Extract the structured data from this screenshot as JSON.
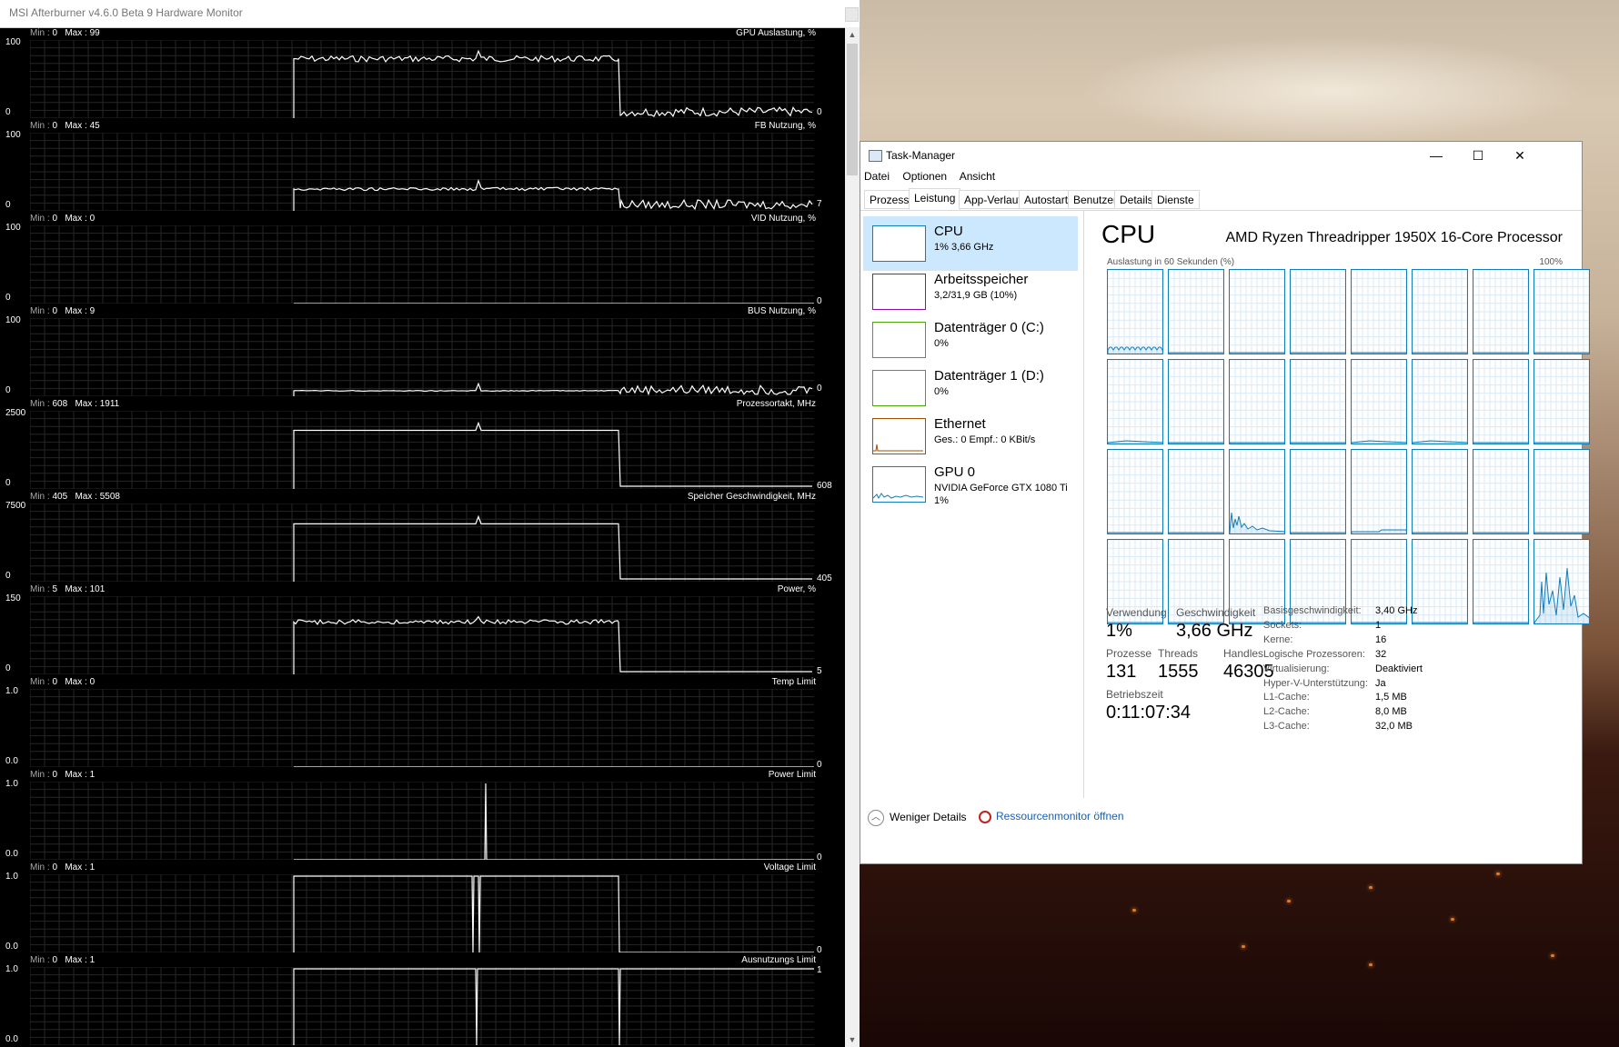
{
  "msi": {
    "title": "MSI Afterburner v4.6.0 Beta 9 Hardware Monitor",
    "graphs": [
      {
        "name": "GPU Auslastung, %",
        "min": "0",
        "max": "99",
        "ytop": "100",
        "ybot": "0",
        "current": "0"
      },
      {
        "name": "FB Nutzung, %",
        "min": "0",
        "max": "45",
        "ytop": "100",
        "ybot": "0",
        "current": "7"
      },
      {
        "name": "VID Nutzung, %",
        "min": "0",
        "max": "0",
        "ytop": "100",
        "ybot": "0",
        "current": "0"
      },
      {
        "name": "BUS Nutzung, %",
        "min": "0",
        "max": "9",
        "ytop": "100",
        "ybot": "0",
        "current": "0"
      },
      {
        "name": "Prozessortakt, MHz",
        "min": "608",
        "max": "1911",
        "ytop": "2500",
        "ybot": "0",
        "current": "608"
      },
      {
        "name": "Speicher Geschwindigkeit, MHz",
        "min": "405",
        "max": "5508",
        "ytop": "7500",
        "ybot": "0",
        "current": "405"
      },
      {
        "name": "Power, %",
        "min": "5",
        "max": "101",
        "ytop": "150",
        "ybot": "0",
        "current": "5"
      },
      {
        "name": "Temp Limit",
        "min": "0",
        "max": "0",
        "ytop": "1.0",
        "ybot": "0.0",
        "current": "0"
      },
      {
        "name": "Power Limit",
        "min": "0",
        "max": "1",
        "ytop": "1.0",
        "ybot": "0.0",
        "current": "0"
      },
      {
        "name": "Voltage Limit",
        "min": "0",
        "max": "1",
        "ytop": "1.0",
        "ybot": "0.0",
        "current": "0"
      },
      {
        "name": "Ausnutzungs Limit",
        "min": "0",
        "max": "1",
        "ytop": "1.0",
        "ybot": "0.0",
        "current": "1"
      }
    ]
  },
  "tm": {
    "title": "Task-Manager",
    "menu": [
      "Datei",
      "Optionen",
      "Ansicht"
    ],
    "tabs": [
      "Prozesse",
      "Leistung",
      "App-Verlauf",
      "Autostart",
      "Benutzer",
      "Details",
      "Dienste"
    ],
    "active_tab": "Leistung",
    "sidebar": [
      {
        "name": "CPU",
        "sub": "1% 3,66 GHz",
        "sub2": "",
        "color": "#117dbb"
      },
      {
        "name": "Arbeitsspeicher",
        "sub": "3,2/31,9 GB (10%)",
        "sub2": "",
        "color": "#8b12ae"
      },
      {
        "name": "Datenträger 0 (C:)",
        "sub": "0%",
        "sub2": "",
        "color": "#4da60c"
      },
      {
        "name": "Datenträger 1 (D:)",
        "sub": "0%",
        "sub2": "",
        "color": "#4da60c"
      },
      {
        "name": "Ethernet",
        "sub": "Ges.: 0 Empf.: 0 KBit/s",
        "sub2": "",
        "color": "#a74f01"
      },
      {
        "name": "GPU 0",
        "sub": "NVIDIA GeForce GTX 1080 Ti",
        "sub2": "1%",
        "color": "#117dbb"
      }
    ],
    "cpu_heading": "CPU",
    "cpu_model": "AMD Ryzen Threadripper 1950X 16-Core Processor",
    "util_label": "Auslastung in 60 Sekunden (%)",
    "util_max": "100%",
    "stats": {
      "verwendung_label": "Verwendung",
      "verwendung": "1%",
      "geschw_label": "Geschwindigkeit",
      "geschw": "3,66 GHz",
      "prozesse_label": "Prozesse",
      "prozesse": "131",
      "threads_label": "Threads",
      "threads": "1555",
      "handles_label": "Handles",
      "handles": "46305",
      "betrieb_label": "Betriebszeit",
      "betrieb": "0:11:07:34"
    },
    "props": [
      {
        "k": "Basisgeschwindigkeit:",
        "v": "3,40 GHz"
      },
      {
        "k": "Sockets:",
        "v": "1"
      },
      {
        "k": "Kerne:",
        "v": "16"
      },
      {
        "k": "Logische Prozessoren:",
        "v": "32"
      },
      {
        "k": "Virtualisierung:",
        "v": "Deaktiviert"
      },
      {
        "k": "Hyper-V-Unterstützung:",
        "v": "Ja"
      },
      {
        "k": "L1-Cache:",
        "v": "1,5 MB"
      },
      {
        "k": "L2-Cache:",
        "v": "8,0 MB"
      },
      {
        "k": "L3-Cache:",
        "v": "32,0 MB"
      }
    ],
    "footer": {
      "less": "Weniger Details",
      "resmon": "Ressourcenmonitor öffnen"
    },
    "accent": "#117dbb",
    "selected_bg": "#cce8ff"
  }
}
